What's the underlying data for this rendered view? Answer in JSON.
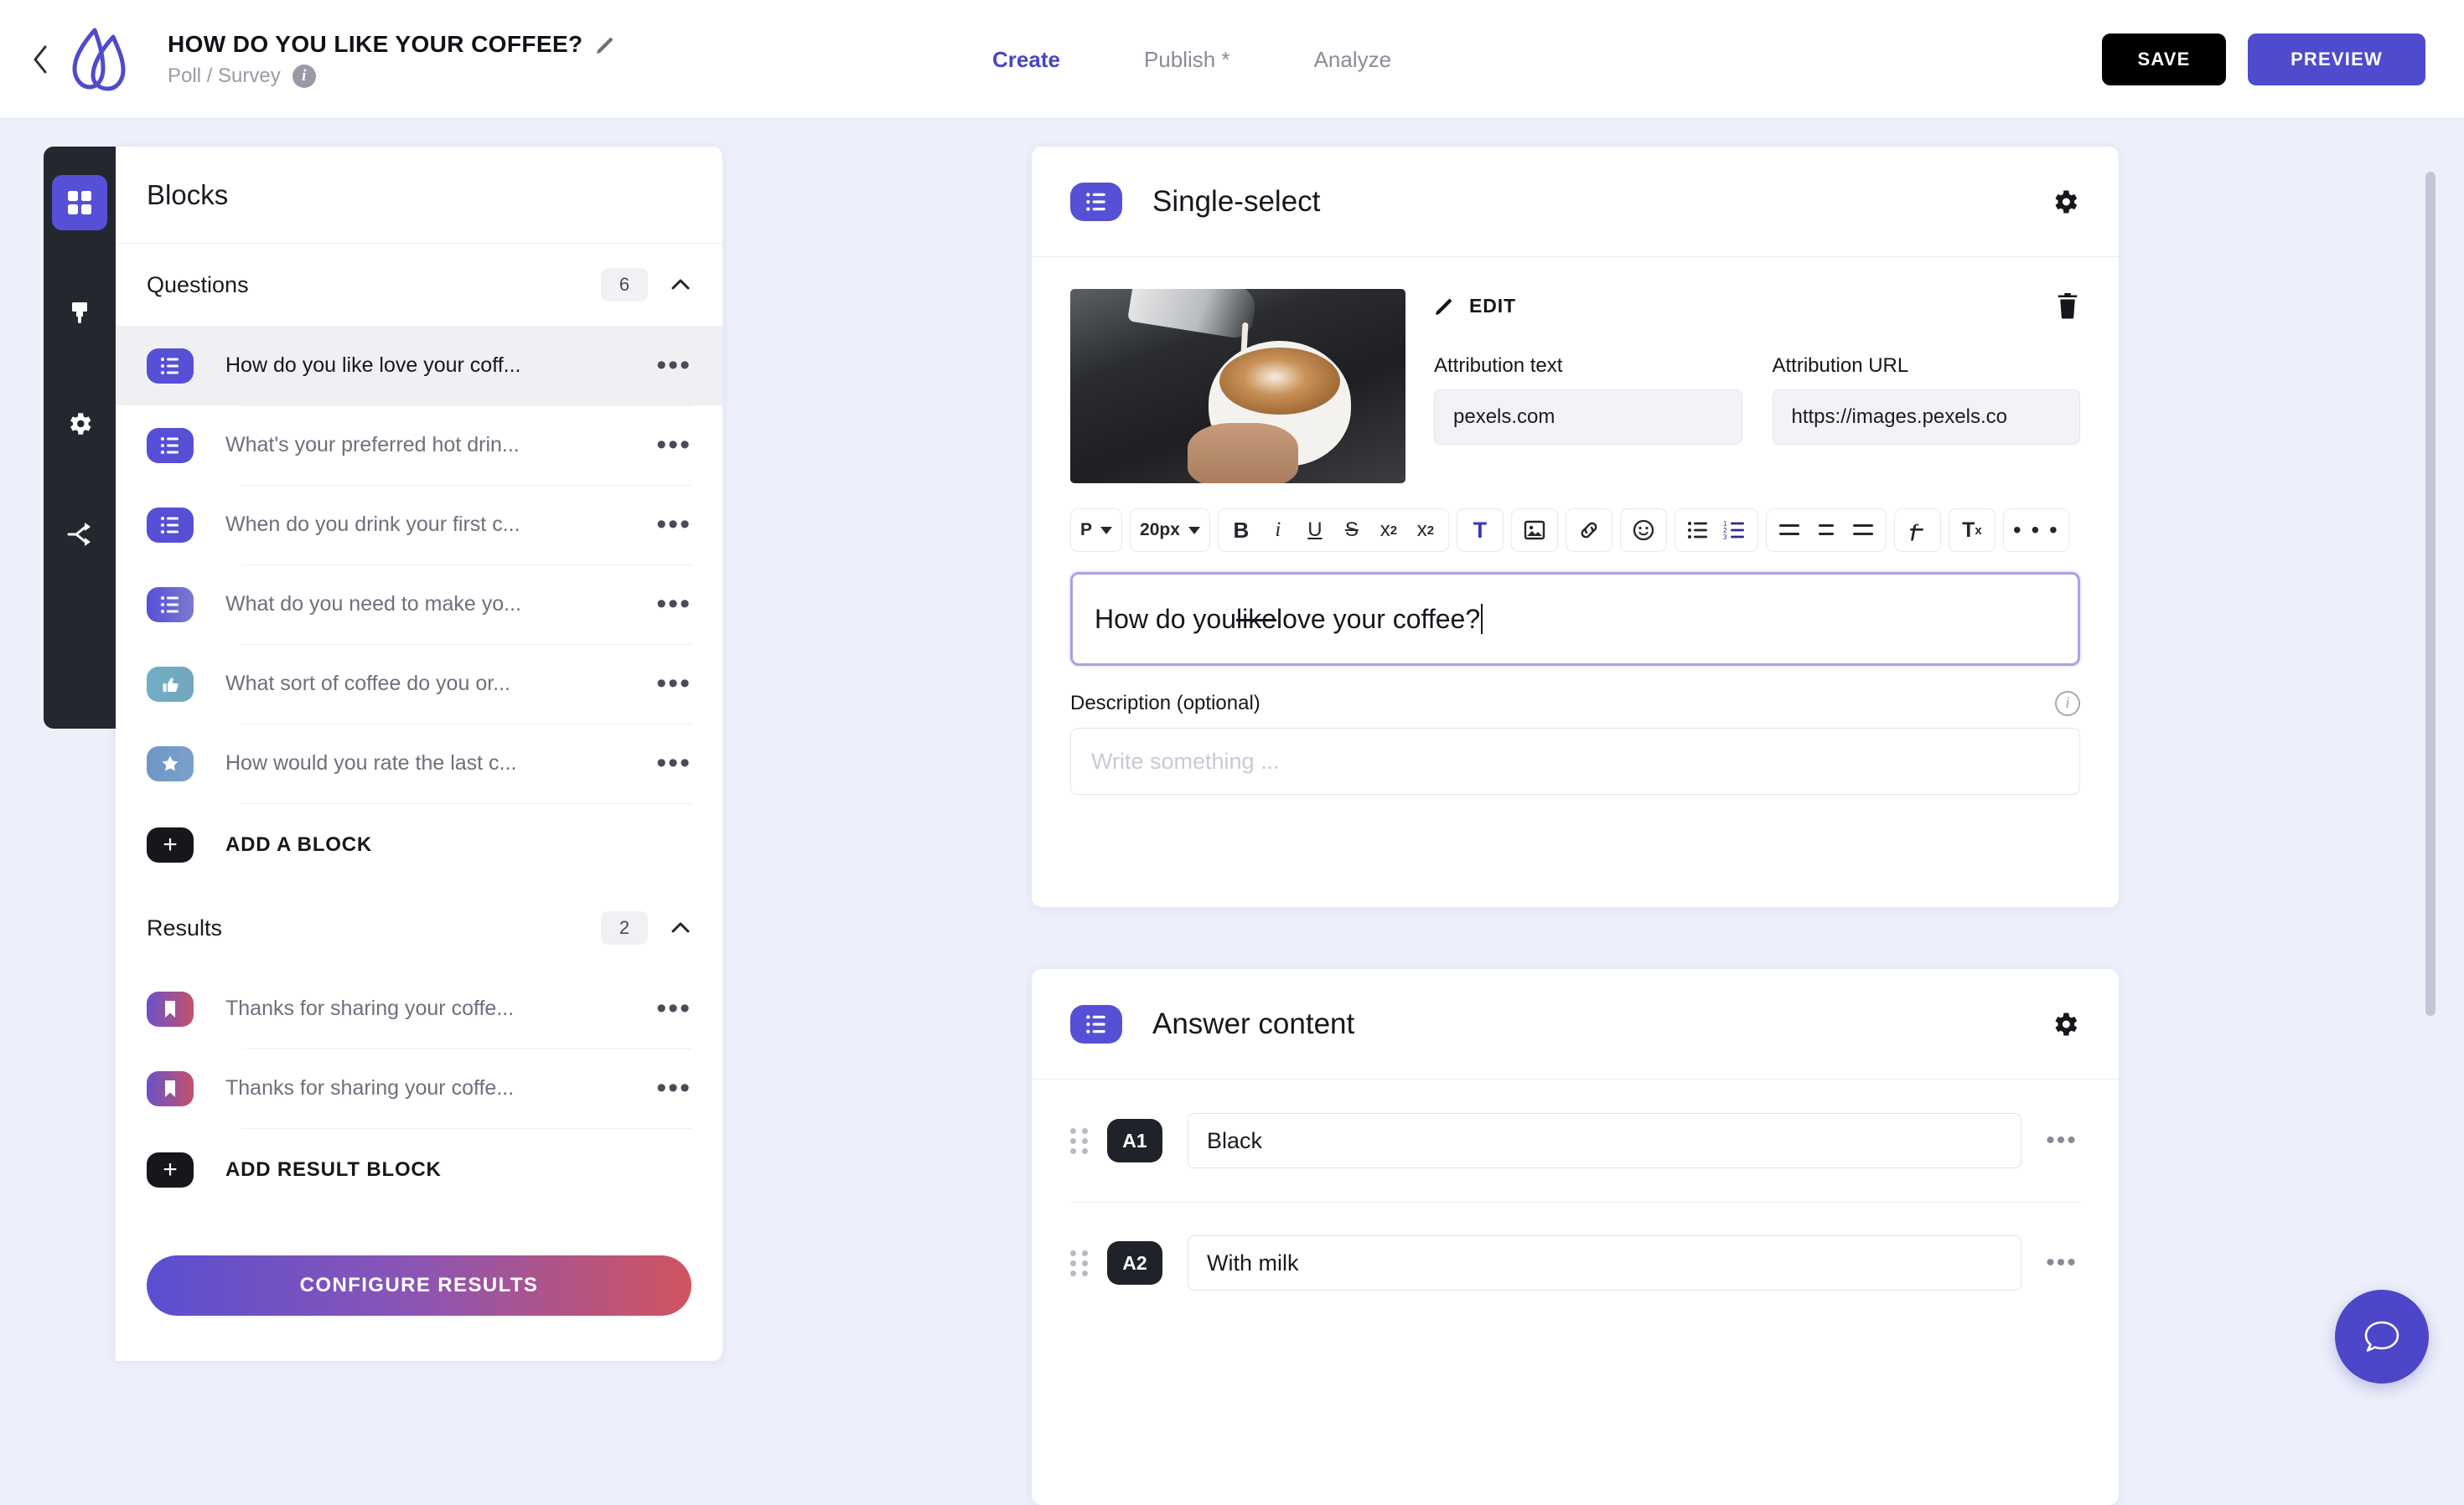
{
  "topbar": {
    "back_icon": "chevron-left-icon",
    "logo_icon": "brand-logo-icon",
    "project_title": "HOW DO YOU LIKE YOUR COFFEE?",
    "edit_title_icon": "pencil-icon",
    "project_subtitle": "Poll / Survey",
    "info_icon": "info-icon",
    "tabs": [
      {
        "label": "Create",
        "active": true
      },
      {
        "label": "Publish *",
        "active": false
      },
      {
        "label": "Analyze",
        "active": false
      }
    ],
    "save_label": "SAVE",
    "preview_label": "PREVIEW"
  },
  "rail": {
    "items": [
      {
        "name": "blocks",
        "icon": "grid-icon",
        "active": true
      },
      {
        "name": "design",
        "icon": "paintbrush-icon",
        "active": false
      },
      {
        "name": "settings",
        "icon": "gear-icon",
        "active": false
      },
      {
        "name": "logic",
        "icon": "share-branch-icon",
        "active": false
      }
    ]
  },
  "panel": {
    "title": "Blocks",
    "questions_section": {
      "title": "Questions",
      "count": "6",
      "collapse_icon": "chevron-up-icon",
      "items": [
        {
          "label": "How do you like love your coff...",
          "icon": "single-select-icon",
          "style": "ic-single",
          "selected": true
        },
        {
          "label": "What's your preferred hot drin...",
          "icon": "single-select-icon",
          "style": "ic-single",
          "selected": false
        },
        {
          "label": "When do you drink your first c...",
          "icon": "single-select-icon",
          "style": "ic-single",
          "selected": false
        },
        {
          "label": "What do you need to make yo...",
          "icon": "multi-select-icon",
          "style": "ic-multi",
          "selected": false
        },
        {
          "label": "What sort of coffee do you or...",
          "icon": "thumbs-up-icon",
          "style": "ic-thumb",
          "selected": false
        },
        {
          "label": "How would you rate the last c...",
          "icon": "star-icon",
          "style": "ic-star",
          "selected": false
        }
      ],
      "add_label": "ADD A BLOCK",
      "add_icon": "plus-icon"
    },
    "results_section": {
      "title": "Results",
      "count": "2",
      "collapse_icon": "chevron-up-icon",
      "items": [
        {
          "label": "Thanks for sharing your coffe...",
          "icon": "bookmark-icon",
          "style": "ic-result"
        },
        {
          "label": "Thanks for sharing your coffe...",
          "icon": "bookmark-icon",
          "style": "ic-result"
        }
      ],
      "add_label": "ADD RESULT BLOCK",
      "add_icon": "plus-icon"
    },
    "configure_results_label": "CONFIGURE RESULTS",
    "row_menu_icon": "ellipsis-icon"
  },
  "question_card": {
    "type_icon": "single-select-icon",
    "title": "Single-select",
    "settings_icon": "gear-icon",
    "media": {
      "thumbnail_alt": "latte-art-coffee-photo",
      "edit_label": "EDIT",
      "edit_icon": "pencil-icon",
      "delete_icon": "trash-icon",
      "attribution_text_label": "Attribution text",
      "attribution_text_value": "pexels.com",
      "attribution_url_label": "Attribution URL",
      "attribution_url_value": "https://images.pexels.co"
    },
    "toolbar": {
      "paragraph_label": "P",
      "font_size_label": "20px",
      "bold_label": "B",
      "italic_label": "i",
      "underline_label": "U",
      "strike_label": "S",
      "superscript_label": "x",
      "superscript_sup": "2",
      "subscript_label": "x",
      "subscript_sub": "2",
      "text_color_label": "T",
      "image_icon": "image-icon",
      "link_icon": "link-icon",
      "emoji_icon": "smiley-icon",
      "bullet_list_icon": "bullet-list-icon",
      "numbered_list_icon": "numbered-list-icon",
      "align_left_icon": "align-left-icon",
      "align_center_icon": "align-center-icon",
      "align_right_icon": "align-right-icon",
      "formula_icon": "formula-icon",
      "clear_format_label": "T",
      "clear_format_x": "x",
      "more_label": "• • •"
    },
    "question_text_before": "How do you ",
    "question_text_strike": "like",
    "question_text_after": " love your coffee?",
    "description_label": "Description (optional)",
    "description_info_icon": "info-icon",
    "description_placeholder": "Write something ...",
    "description_value": ""
  },
  "answer_card": {
    "type_icon": "single-select-icon",
    "title": "Answer content",
    "settings_icon": "gear-icon",
    "rows": [
      {
        "tag": "A1",
        "value": "Black",
        "grip_icon": "drag-handle-icon",
        "menu_icon": "ellipsis-icon"
      },
      {
        "tag": "A2",
        "value": "With milk",
        "grip_icon": "drag-handle-icon",
        "menu_icon": "ellipsis-icon"
      }
    ]
  },
  "chat": {
    "icon": "chat-bubble-icon"
  },
  "colors": {
    "accent": "#5650d6",
    "accent_button": "#4f4bcd",
    "save_button": "#000000",
    "rail_bg": "#25272f",
    "page_bg": "#edf0fb",
    "gradient_result_start": "#5a4fd0",
    "gradient_result_end": "#d1545f"
  }
}
